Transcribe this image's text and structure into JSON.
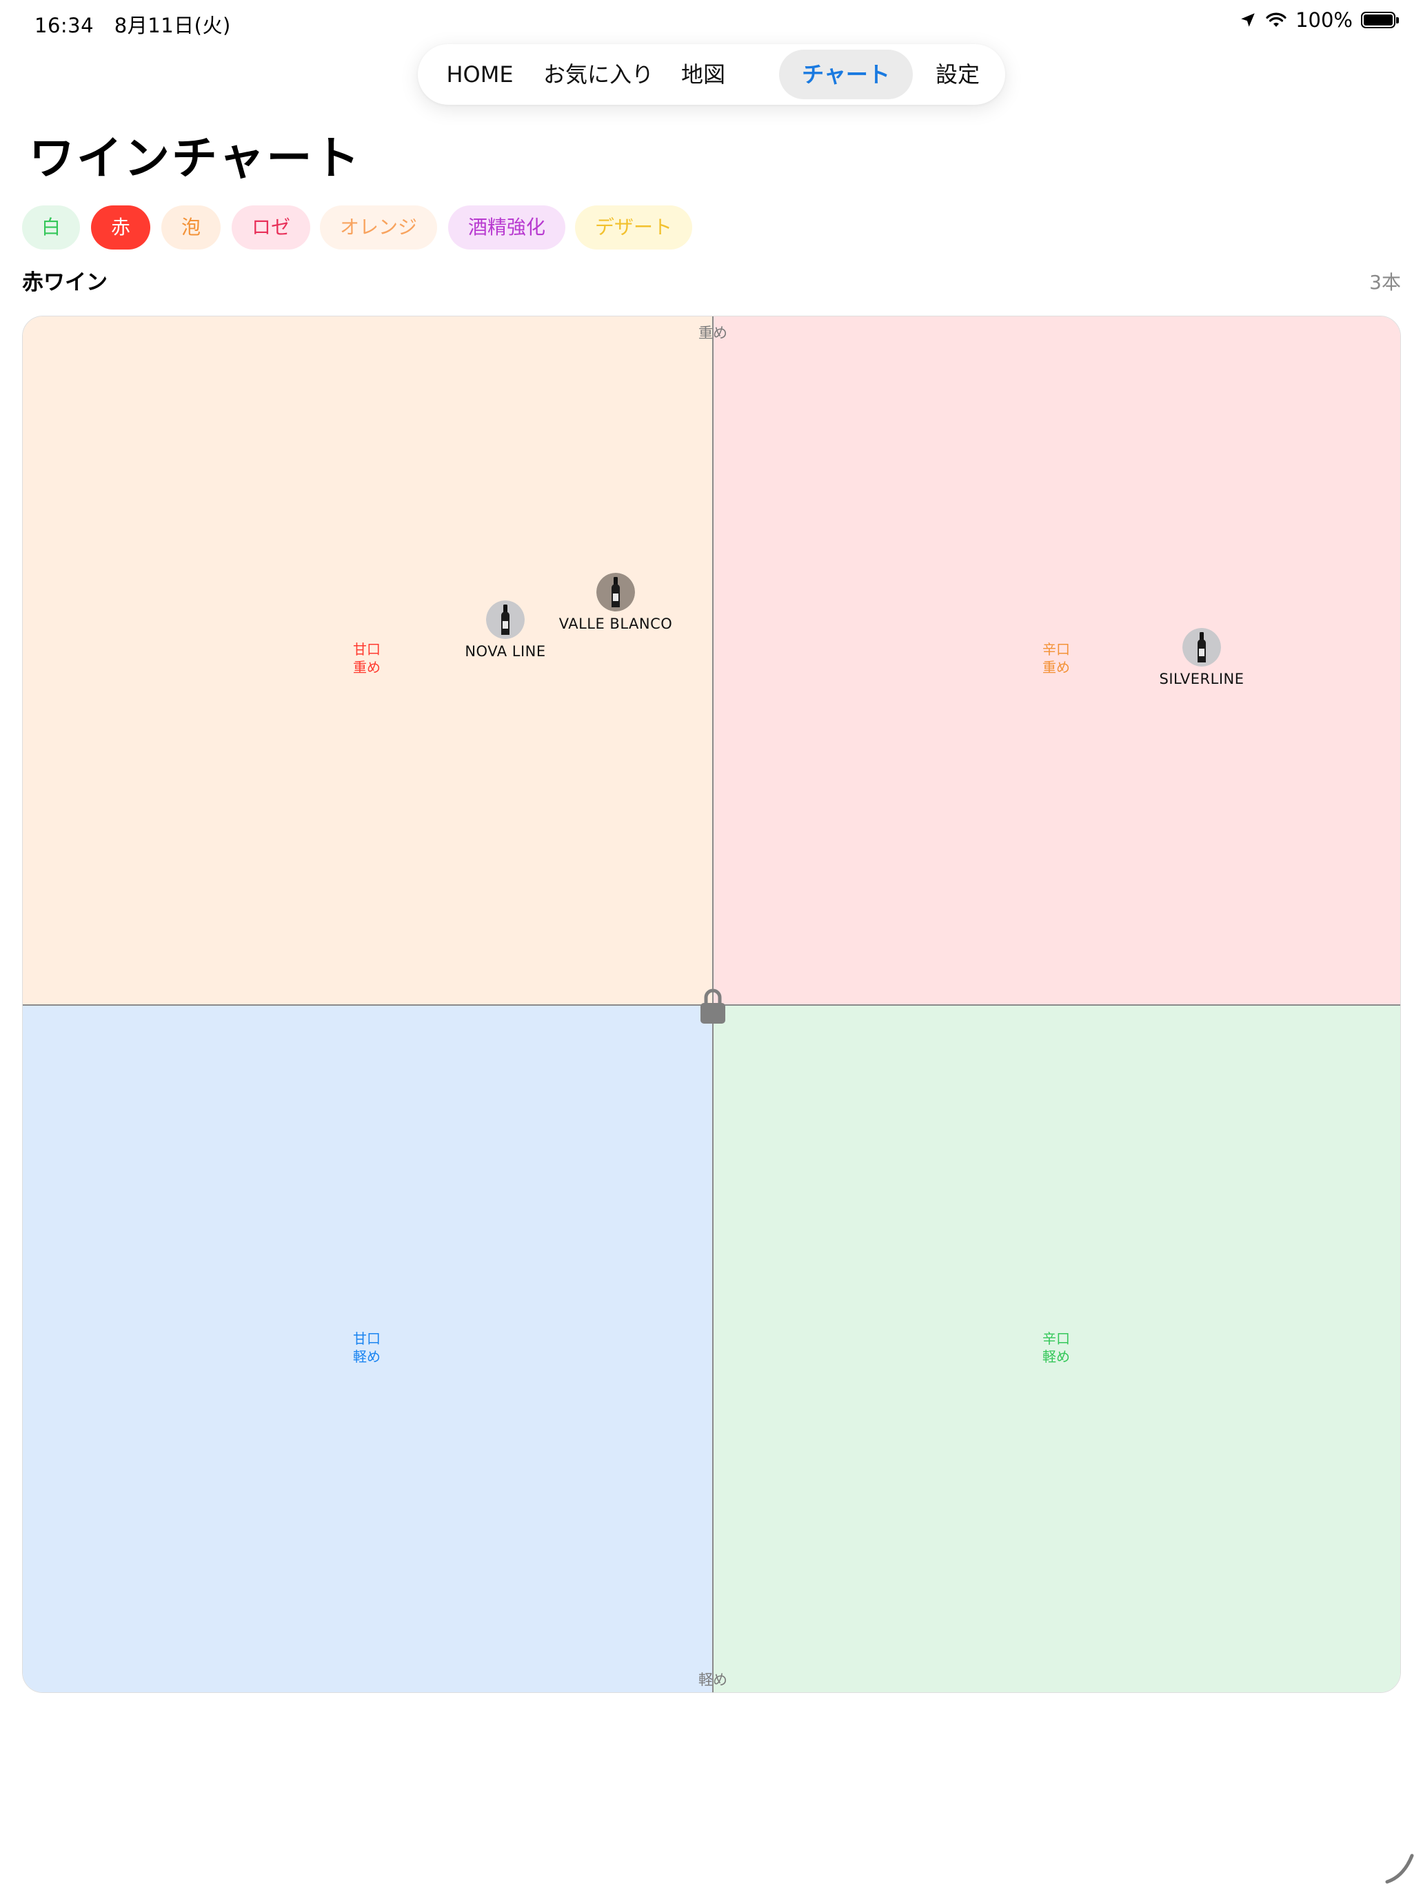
{
  "status_bar": {
    "time": "16:34",
    "date": "8月11日(火)",
    "battery": "100%",
    "battery_level": 1.0
  },
  "tabs": [
    {
      "label": "HOME",
      "active": false
    },
    {
      "label": "お気に入り",
      "active": false
    },
    {
      "label": "地図",
      "active": false
    },
    {
      "label": "チャート",
      "active": true
    },
    {
      "label": "設定",
      "active": false
    }
  ],
  "page_title": "ワインチャート",
  "filters": [
    {
      "label": "白",
      "selected": false,
      "bg": "#e5f7ea",
      "fg": "#34c759"
    },
    {
      "label": "赤",
      "selected": true,
      "bg": "#ff3b30",
      "fg": "#ffffff"
    },
    {
      "label": "泡",
      "selected": false,
      "bg": "#ffeee0",
      "fg": "#f39237"
    },
    {
      "label": "ロゼ",
      "selected": false,
      "bg": "#ffe3ea",
      "fg": "#e8315a"
    },
    {
      "label": "オレンジ",
      "selected": false,
      "bg": "#fff3ea",
      "fg": "#f8a35e"
    },
    {
      "label": "酒精強化",
      "selected": false,
      "bg": "#f7e2fa",
      "fg": "#b83ad0"
    },
    {
      "label": "デザート",
      "selected": false,
      "bg": "#fff8d8",
      "fg": "#f2c12e"
    }
  ],
  "section": {
    "title": "赤ワイン",
    "count": "3本"
  },
  "chart": {
    "axis_top": "重め",
    "axis_bottom": "軽め",
    "quadrants": {
      "top_left": {
        "line1": "甘口",
        "line2": "重め",
        "color": "#ff3b30"
      },
      "top_right": {
        "line1": "辛口",
        "line2": "重め",
        "color": "#f39237"
      },
      "bottom_left": {
        "line1": "甘口",
        "line2": "軽め",
        "color": "#1a84f0"
      },
      "bottom_right": {
        "line1": "辛口",
        "line2": "軽め",
        "color": "#34c759"
      }
    },
    "lock_icon": "lock-icon"
  },
  "chart_data": {
    "type": "scatter",
    "x_axis": "甘口 ← → 辛口",
    "y_axis": "軽め ← → 重め",
    "xlim": [
      -1,
      1
    ],
    "ylim": [
      -1,
      1
    ],
    "points": [
      {
        "name": "NOVA LINE",
        "x": -0.3,
        "y": 0.56
      },
      {
        "name": "VALLE BLANCO",
        "x": -0.14,
        "y": 0.6
      },
      {
        "name": "SILVERLINE",
        "x": 0.71,
        "y": 0.52
      }
    ]
  }
}
